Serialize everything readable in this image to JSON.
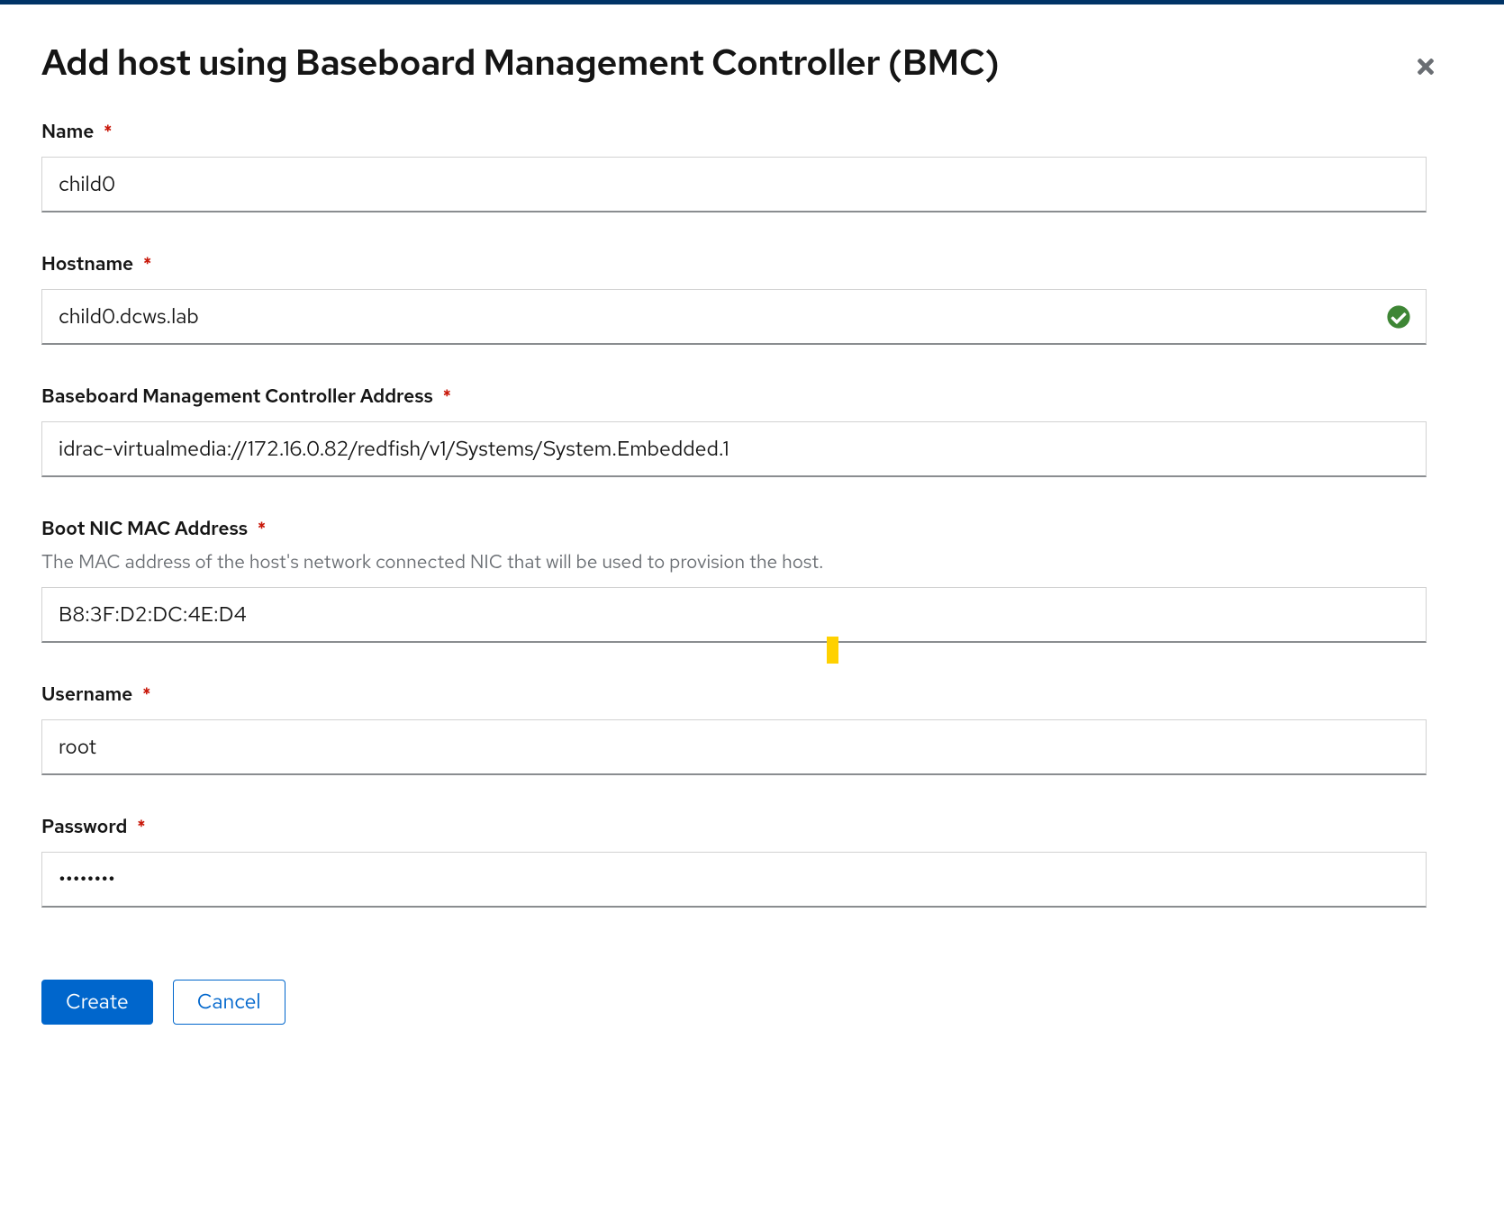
{
  "modal": {
    "title": "Add host using Baseboard Management Controller (BMC)"
  },
  "fields": {
    "name": {
      "label": "Name",
      "value": "child0",
      "required": true
    },
    "hostname": {
      "label": "Hostname",
      "value": "child0.dcws.lab",
      "required": true,
      "validated": true
    },
    "bmc_address": {
      "label": "Baseboard Management Controller Address",
      "value": "idrac-virtualmedia://172.16.0.82/redfish/v1/Systems/System.Embedded.1",
      "required": true
    },
    "boot_mac": {
      "label": "Boot NIC MAC Address",
      "help": "The MAC address of the host's network connected NIC that will be used to provision the host.",
      "value": "B8:3F:D2:DC:4E:D4",
      "required": true
    },
    "username": {
      "label": "Username",
      "value": "root",
      "required": true
    },
    "password": {
      "label": "Password",
      "value": "••••••••",
      "required": true
    }
  },
  "actions": {
    "create": "Create",
    "cancel": "Cancel"
  }
}
